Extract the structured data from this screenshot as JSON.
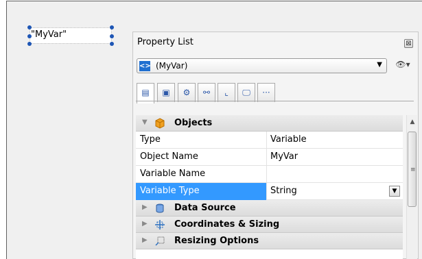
{
  "canvas": {
    "variable_label": "\"MyVar\""
  },
  "property_window": {
    "title": "Property List",
    "close_glyph": "⊠",
    "object_select": {
      "icon_glyph": "<>",
      "value": "(MyVar)",
      "arrow_glyph": "▼"
    },
    "eye_glyph": "👁▾",
    "tabs": [
      {
        "name": "tab-properties",
        "glyph": "▤",
        "active": true
      },
      {
        "name": "tab-form",
        "glyph": "▣",
        "active": false
      },
      {
        "name": "tab-events",
        "glyph": "⚙",
        "active": false
      },
      {
        "name": "tab-layout",
        "glyph": "⚯",
        "active": false
      },
      {
        "name": "tab-chart",
        "glyph": "⌞",
        "active": false
      },
      {
        "name": "tab-display",
        "glyph": "🖵",
        "active": false
      },
      {
        "name": "tab-more",
        "glyph": "···",
        "active": false
      }
    ],
    "groups": {
      "objects": {
        "label": "Objects",
        "arrow": "▼",
        "icon": "cube-icon"
      },
      "data_source": {
        "label": "Data Source",
        "arrow": "▶",
        "icon": "database-icon"
      },
      "coordinates": {
        "label": "Coordinates & Sizing",
        "arrow": "▶",
        "icon": "coordinates-icon"
      },
      "resizing": {
        "label": "Resizing Options",
        "arrow": "▶",
        "icon": "resize-icon"
      }
    },
    "properties": [
      {
        "name": "Type",
        "value": "Variable"
      },
      {
        "name": "Object Name",
        "value": "MyVar"
      },
      {
        "name": "Variable Name",
        "value": ""
      },
      {
        "name": "Variable Type",
        "value": "String",
        "selected": true
      }
    ]
  },
  "colors": {
    "selection": "#3399ff",
    "handle": "#1e56b5"
  }
}
